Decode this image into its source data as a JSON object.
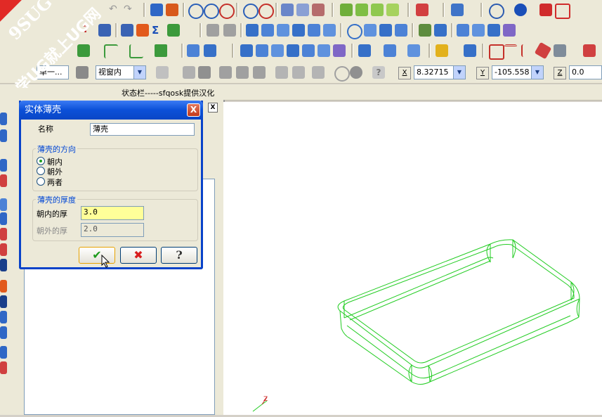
{
  "watermark": {
    "brand": "9SUG",
    "slogan": "学UG就上UG网"
  },
  "toolbar": {
    "selection_filter": "单一...",
    "view_scope": "视窗内",
    "coords": {
      "x_label": "X",
      "x_value": "8.32715",
      "y_label": "Y",
      "y_value": "-105.558",
      "z_label": "Z",
      "z_value": "0.0"
    }
  },
  "status_bar": {
    "text": "状态栏-----sfqosk提供汉化"
  },
  "side_panel": {
    "close_label": "X"
  },
  "dialog": {
    "title": "实体薄壳",
    "close_label": "X",
    "name_label": "名称",
    "name_value": "薄壳",
    "direction_group": {
      "label": "薄壳的方向",
      "options": [
        "朝内",
        "朝外",
        "两者"
      ],
      "selected": "朝内"
    },
    "thickness_group": {
      "label": "薄壳的厚度",
      "inner_label": "朝内的厚",
      "inner_value": "3.0",
      "outer_label": "朝外的厚",
      "outer_value": "2.0"
    },
    "ok_label": "✔",
    "cancel_label": "✖",
    "help_label": "?"
  },
  "viewport": {
    "axis_label": "Z"
  },
  "colors": {
    "wireframe": "#22cc22",
    "highlight_input": "#ffff99",
    "title_bar": "#0b50d8"
  }
}
